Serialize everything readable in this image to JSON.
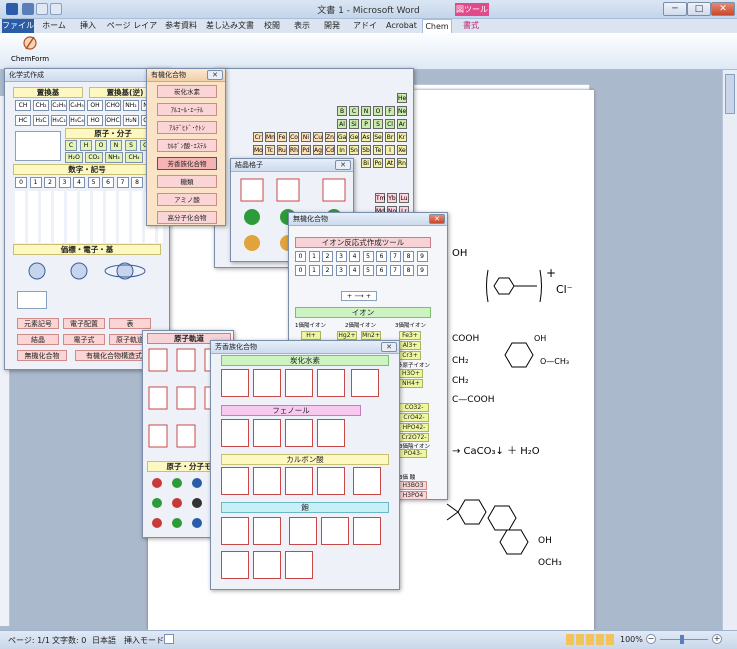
{
  "window": {
    "title": "文書 1 - Microsoft Word",
    "context_tab_label": "図ツール",
    "minimize": "─",
    "restore": "□",
    "close": "✕"
  },
  "ribbon": {
    "tabs": [
      "ファイル",
      "ホーム",
      "挿入",
      "ページ レイアウト",
      "参考資料",
      "差し込み文書",
      "校閲",
      "表示",
      "開発",
      "アドイン",
      "Acrobat",
      "Chem",
      "書式"
    ],
    "active_tab": "Chem",
    "chemform_label": "ChemForm"
  },
  "statusbar": {
    "page": "ページ: 1/1",
    "words": "文字数: 0",
    "language": "日本語",
    "mode": "挿入モード",
    "zoom": "100%",
    "zoom_minus": "−",
    "zoom_plus": "+"
  },
  "kagaku": {
    "title": "化学式作成",
    "sec_substituent": "置換基",
    "sec_substituent_rev": "置換基(逆)",
    "sub_row1": [
      "CH",
      "CH₂",
      "C₂H₅",
      "C₆H₅",
      "OH",
      "CHO",
      "NH₂",
      "NO₂"
    ],
    "sub_row2": [
      "HC",
      "H₃C",
      "H₅C₂",
      "H₅C₆",
      "HO",
      "OHC",
      "H₂N",
      "O₂N"
    ],
    "sec_atom_mol": "原子・分子",
    "mol_row1": [
      "C",
      "H",
      "O",
      "N",
      "S",
      "Cl"
    ],
    "mol_row2": [
      "H₂O",
      "CO₂",
      "NH₃",
      "CH₄"
    ],
    "sec_numbers": "数字・記号",
    "num_row": [
      "0",
      "1",
      "2",
      "3",
      "4",
      "5",
      "6",
      "7",
      "8",
      "9"
    ],
    "sec_valence": "価標・電子・基",
    "bottom_buttons": [
      "元素記号",
      "電子配置",
      "表",
      "結晶",
      "電子式",
      "原子軌道",
      "無機化合物",
      "有機化合物構造式"
    ]
  },
  "yuki": {
    "title": "有機化合物",
    "items": [
      "炭化水素",
      "ｱﾙｺｰﾙ･ｴｰﾃﾙ",
      "ｱﾙﾃﾞﾋﾄﾞ･ｹﾄﾝ",
      "ｶﾙﾎﾞﾝ酸･ｴｽﾃﾙ",
      "芳香族化合物",
      "糖類",
      "アミノ酸",
      "高分子化合物"
    ]
  },
  "periodic": {
    "cells": [
      "He",
      "B",
      "C",
      "N",
      "O",
      "F",
      "Ne",
      "Al",
      "Si",
      "P",
      "S",
      "Cl",
      "Ar",
      "Cr",
      "Mn",
      "Fe",
      "Co",
      "Ni",
      "Cu",
      "Zn",
      "Ga",
      "Ge",
      "As",
      "Se",
      "Br",
      "Kr",
      "Mo",
      "Tc",
      "Ru",
      "Rh",
      "Pd",
      "Ag",
      "Cd",
      "In",
      "Sn",
      "Sb",
      "Te",
      "I",
      "Xe",
      "Bi",
      "Po",
      "At",
      "Rn",
      "Tm",
      "Yb",
      "Lu",
      "Md",
      "No",
      "Lr"
    ]
  },
  "kessho": {
    "title": "結晶格子"
  },
  "muki": {
    "title": "無機化合物"
  },
  "ion": {
    "title": "イオン反応式作成ツール",
    "nums1": [
      "0",
      "1",
      "2",
      "3",
      "4",
      "5",
      "6",
      "7",
      "8",
      "9"
    ],
    "nums2": [
      "0",
      "1",
      "2",
      "3",
      "4",
      "5",
      "6",
      "7",
      "8",
      "9"
    ],
    "arrow": "+ ⟶ +",
    "sec_ion": "イオン",
    "col1": "1価陽イオン",
    "col2": "2価陽イオン",
    "col3": "3価陽イオン",
    "ions1": [
      "H+"
    ],
    "ions2": [
      "Hg2+",
      "Mn2+"
    ],
    "ions3": [
      "Fe3+",
      "Al3+",
      "Cr3+"
    ],
    "ions4_label": "多原子イオン",
    "ions4": [
      "H3O+",
      "NH4+"
    ],
    "ions5": [
      "CO32-",
      "CrO42-",
      "HPO42-",
      "Cr2O72-"
    ],
    "ions6_label": "3価陰イオン",
    "ions6": [
      "PO43-"
    ],
    "sec_acid": "3価 酸",
    "acids": [
      "H3BO3",
      "H3PO4"
    ]
  },
  "kido": {
    "title": "原子軌道",
    "sec_atom_mol": "原子・分子モ"
  },
  "aromatic": {
    "title": "芳香族化合物",
    "sec_hydrocarbon": "炭化水素",
    "sec_phenol": "フェノール",
    "sec_carboxylic": "カルボン酸",
    "sec_salt": "飽"
  },
  "document": {
    "cl": "Cl⁻",
    "plus": "+",
    "cooh1": "COOH",
    "ch2a": "CH₂",
    "ch2b": "CH₂",
    "cooh2": "C—COOH",
    "oh1": "OH",
    "och3": "O—CH₃",
    "caco3": "→ CaCO₃↓ ＋ H₂O",
    "oh2": "OH",
    "och3b": "OCH₃",
    "oh_top": "OH"
  }
}
